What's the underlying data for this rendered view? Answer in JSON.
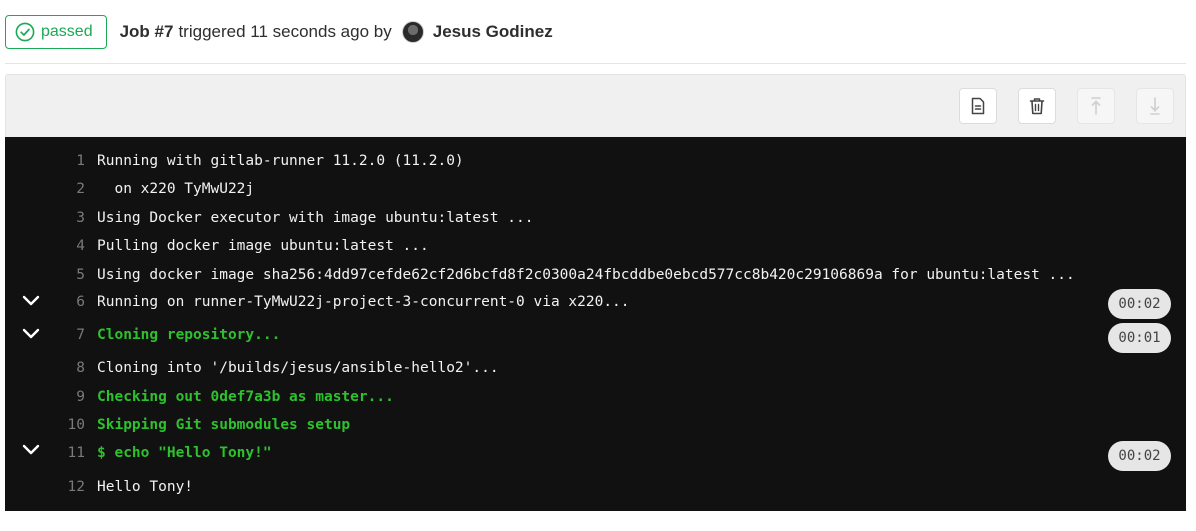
{
  "header": {
    "status": "passed",
    "job_title": "Job #7",
    "triggered_text": "triggered 11 seconds ago by",
    "author": "Jesus Godinez"
  },
  "toolbar": {
    "buttons": [
      {
        "name": "show-complete-raw",
        "icon": "file-text-icon",
        "enabled": true
      },
      {
        "name": "erase-log",
        "icon": "trash-icon",
        "enabled": true
      },
      {
        "name": "scroll-top",
        "icon": "scroll-up-icon",
        "enabled": false
      },
      {
        "name": "scroll-bottom",
        "icon": "scroll-down-icon",
        "enabled": false
      }
    ]
  },
  "log": {
    "lines": [
      {
        "num": "1",
        "text": "Running with gitlab-runner 11.2.0 (11.2.0)"
      },
      {
        "num": "2",
        "text": "  on x220 TyMwU22j"
      },
      {
        "num": "3",
        "text": "Using Docker executor with image ubuntu:latest ..."
      },
      {
        "num": "4",
        "text": "Pulling docker image ubuntu:latest ..."
      },
      {
        "num": "5",
        "text": "Using docker image sha256:4dd97cefde62cf2d6bcfd8f2c0300a24fbcddbe0ebcd577cc8b420c29106869a for ubuntu:latest ..."
      },
      {
        "num": "6",
        "text": "Running on runner-TyMwU22j-project-3-concurrent-0 via x220...",
        "duration": "00:02"
      },
      {
        "num": "7",
        "text": "Cloning repository...",
        "duration": "00:01"
      },
      {
        "num": "8",
        "text": "Cloning into '/builds/jesus/ansible-hello2'..."
      },
      {
        "num": "9",
        "text": "Checking out 0def7a3b as master..."
      },
      {
        "num": "10",
        "text": "Skipping Git submodules setup"
      },
      {
        "num": "11",
        "text": "$ echo \"Hello Tony!\"",
        "duration": "00:02"
      },
      {
        "num": "12",
        "text": "Hello Tony!"
      }
    ]
  },
  "colors": {
    "success": "#1aaa55",
    "log_background": "#111111",
    "log_text": "#f2f2f2",
    "log_green": "#2dc22d",
    "line_number": "#7a7a7a"
  }
}
